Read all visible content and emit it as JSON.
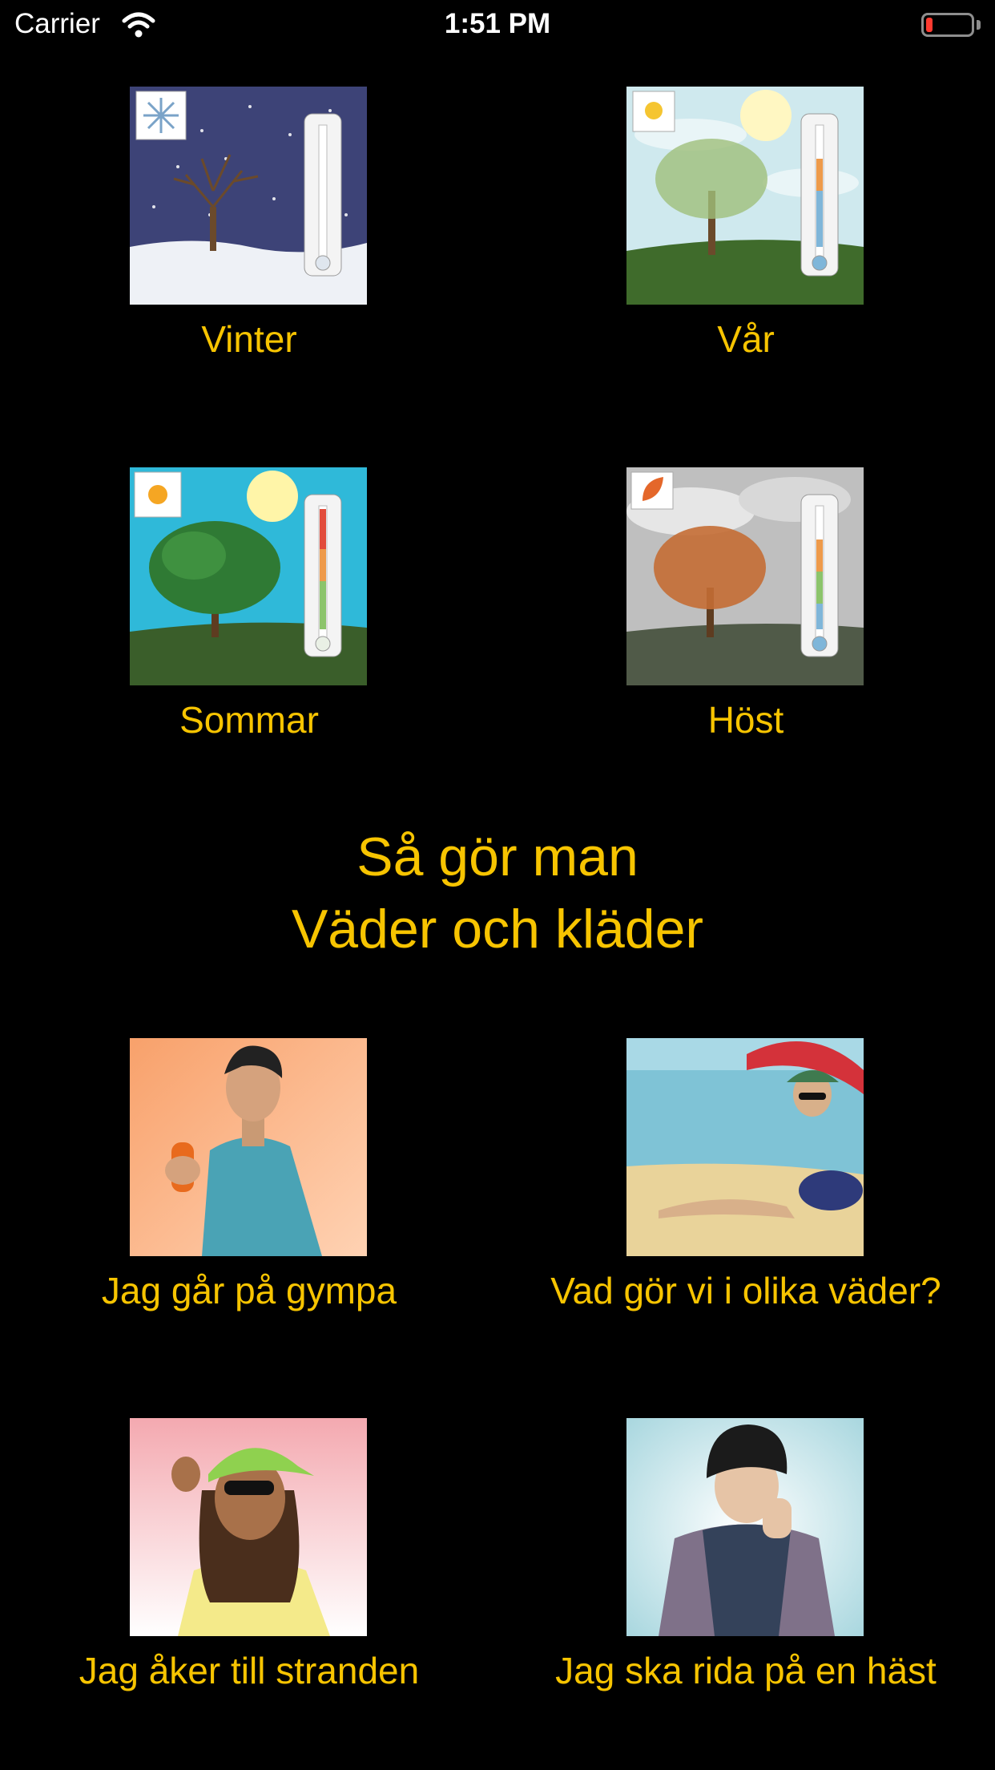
{
  "status_bar": {
    "carrier": "Carrier",
    "time": "1:51 PM",
    "battery_level": 0.15,
    "battery_color": "#ff3b30"
  },
  "seasons": [
    {
      "label": "Vinter",
      "icon": "snowflake-icon"
    },
    {
      "label": "Vår",
      "icon": "sun-cloud-icon"
    },
    {
      "label": "Sommar",
      "icon": "sun-icon"
    },
    {
      "label": "Höst",
      "icon": "leaf-icon"
    }
  ],
  "section": {
    "title_line1": "Så gör man",
    "title_line2": "Väder och kläder"
  },
  "stories": [
    {
      "label": "Jag går på gympa"
    },
    {
      "label": "Vad gör vi i olika väder?"
    },
    {
      "label": "Jag åker till stranden"
    },
    {
      "label": "Jag ska rida på en häst"
    }
  ],
  "colors": {
    "background": "#000000",
    "label_accent": "#f7c400"
  }
}
